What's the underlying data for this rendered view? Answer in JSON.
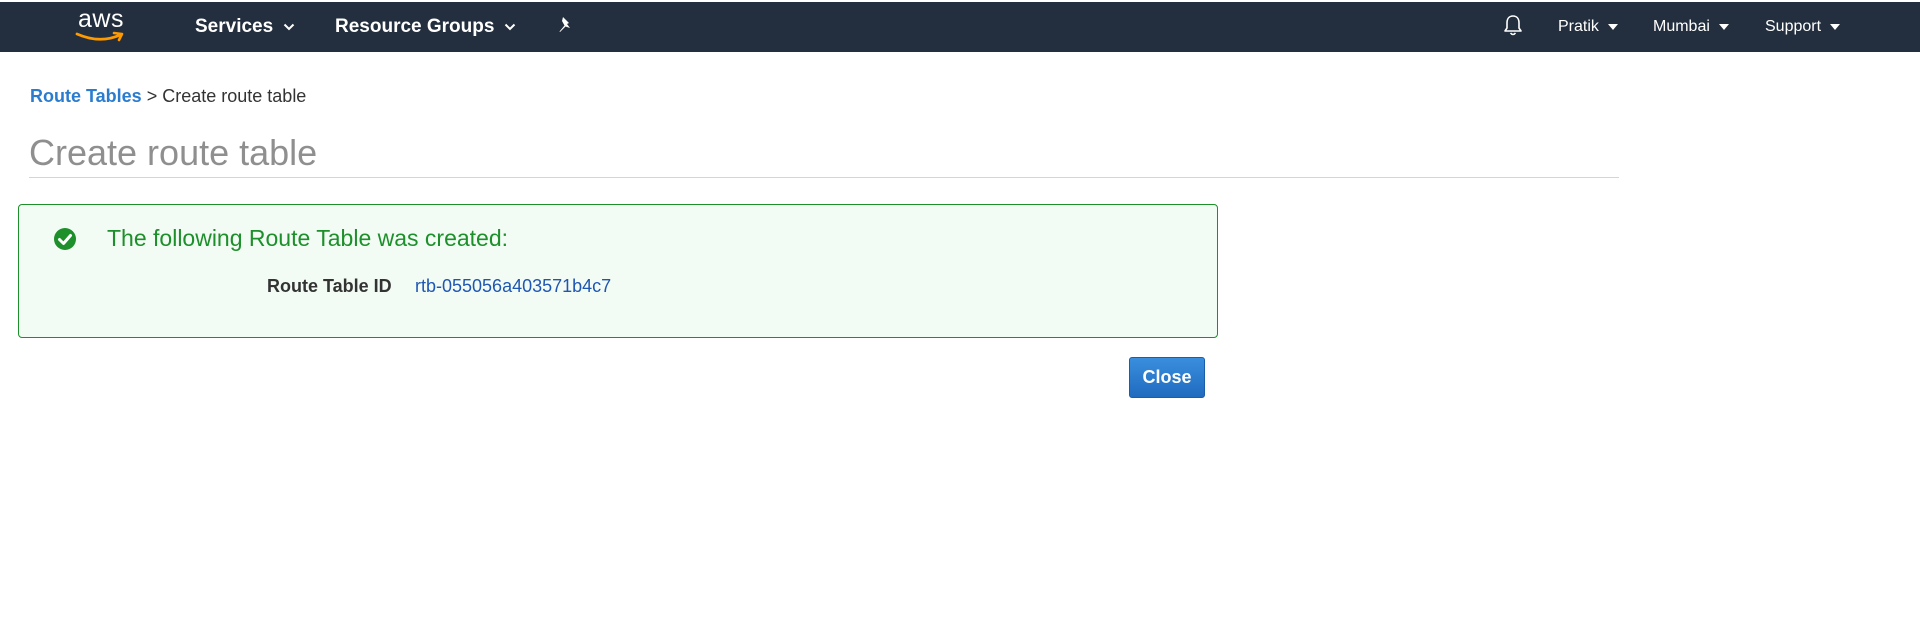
{
  "topnav": {
    "logo_text": "aws",
    "services_label": "Services",
    "resource_groups_label": "Resource Groups",
    "user_label": "Pratik",
    "region_label": "Mumbai",
    "support_label": "Support"
  },
  "breadcrumb": {
    "link_label": "Route Tables",
    "separator": ">",
    "current_label": "Create route table"
  },
  "page": {
    "title": "Create route table"
  },
  "success": {
    "message": "The following Route Table was created:",
    "field_label": "Route Table ID",
    "field_value": "rtb-055056a403571b4c7"
  },
  "actions": {
    "close_label": "Close"
  },
  "colors": {
    "nav_bg": "#232f3e",
    "aws_orange": "#ff9900",
    "link_blue": "#2a7ccf",
    "success_green": "#1d8f2b",
    "success_bg": "#f2fcf4"
  },
  "icons": {
    "chevron": "chevron-down-icon",
    "caret": "caret-down-icon",
    "pin": "pin-icon",
    "bell": "bell-icon",
    "success": "check-circle-icon"
  }
}
